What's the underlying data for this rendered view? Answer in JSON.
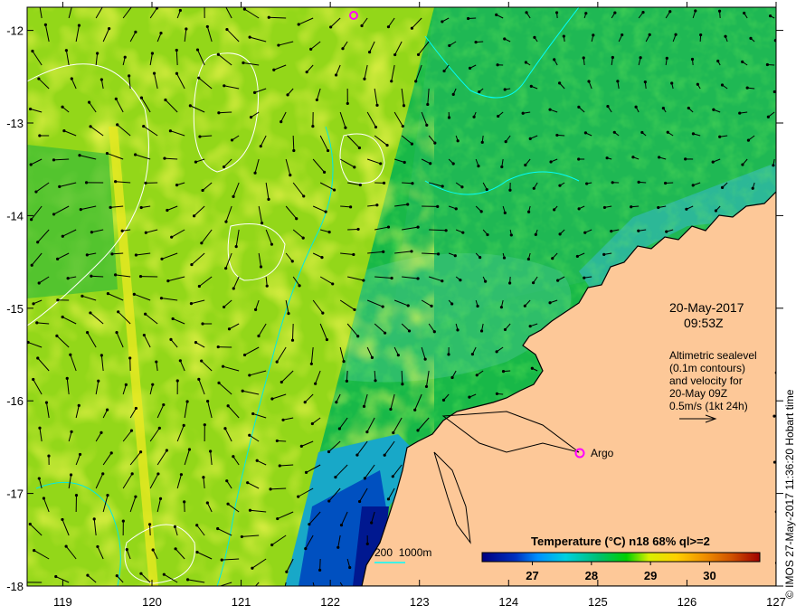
{
  "map": {
    "lon_range": [
      118.6,
      127
    ],
    "lat_range": [
      -18,
      -11.75
    ],
    "x_ticks": [
      "119",
      "120",
      "121",
      "122",
      "123",
      "124",
      "125",
      "126",
      "127"
    ],
    "y_ticks": [
      "-12",
      "-13",
      "-14",
      "-15",
      "-16",
      "-17",
      "-18"
    ]
  },
  "annotations": {
    "date": "20-May-2017",
    "time": "09:53Z",
    "altimetry_lines": [
      "Altimetric sealevel",
      "(0.1m contours)",
      "and velocity for",
      "20-May 09Z",
      "0.5m/s (1kt 24h)"
    ],
    "argo_label": "Argo",
    "bathymetry_legend": "200  1000m",
    "credit": "© IMOS 27-May-2017 11:36:20 Hobart time"
  },
  "colorbar": {
    "title": "Temperature (°C) n18 68% ql>=2",
    "ticks": [
      "27",
      "28",
      "29",
      "30"
    ],
    "range": [
      26.15,
      30.85
    ]
  },
  "colors": {
    "land": "#fdc898",
    "argo": "#ff00ff",
    "bathy": "#00ffff",
    "contour": "#ffffff"
  }
}
